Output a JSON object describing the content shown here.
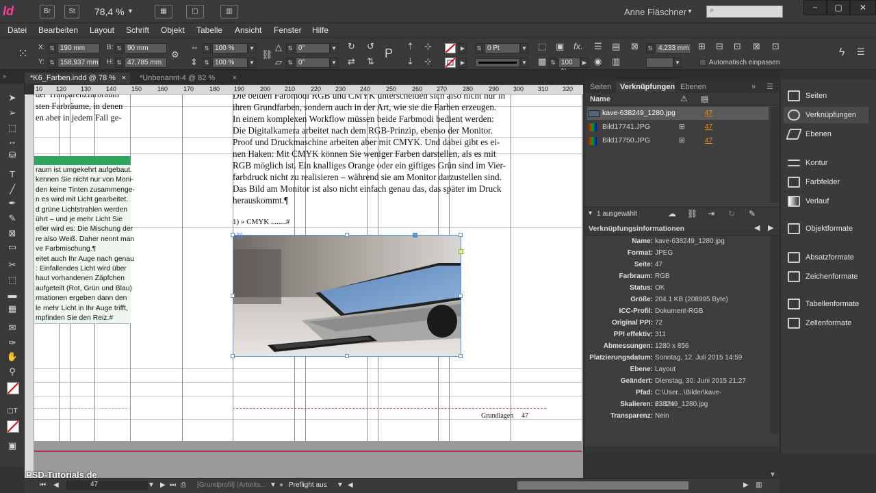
{
  "app": {
    "logo": "Id",
    "bridge_btn": "Br",
    "stock_btn": "St",
    "zoom_level": "78,4 %",
    "user_name": "Anne Fläschner"
  },
  "menu": [
    "Datei",
    "Bearbeiten",
    "Layout",
    "Schrift",
    "Objekt",
    "Tabelle",
    "Ansicht",
    "Fenster",
    "Hilfe"
  ],
  "control": {
    "x_label": "X:",
    "x_value": "190 mm",
    "y_label": "Y:",
    "y_value": "158,937 mm",
    "w_label": "B:",
    "w_value": "90 mm",
    "h_label": "H:",
    "h_value": "47,785 mm",
    "scale_x": "100 %",
    "scale_y": "100 %",
    "angle": "0°",
    "shear": "0°",
    "stroke_weight": "0 Pt",
    "opacity": "100 %",
    "fit_width": "4,233 mm",
    "auto_fit_label": "Automatisch einpassen"
  },
  "tabs": [
    {
      "label": "*K6_Farben.indd @ 78 %",
      "close": "×",
      "active": true
    },
    {
      "label": "*Unbenannt-4 @ 82 %",
      "close": "×",
      "active": false
    }
  ],
  "ruler": {
    "h_ticks": [
      "10",
      "120",
      "130",
      "140",
      "150",
      "160",
      "170",
      "180",
      "190",
      "200",
      "210",
      "220",
      "230",
      "240",
      "250",
      "260",
      "270",
      "280",
      "290",
      "300",
      "310",
      "320",
      "330"
    ]
  },
  "document": {
    "main_text": "Die beiden Farbmodi RGB und CMYK unterscheiden sich also nicht nur in\nihren Grundfarben, sondern auch in der Art, wie sie die Farben erzeugen.\nIn einem komplexen Workflow müssen beide Farbmodi bedient werden:\nDie Digitalkamera arbeitet nach dem RGB-Prinzip, ebenso der Monitor.\nProof und Druckmaschine arbeiten aber mit CMYK. Und dabei gibt es ei-\nnen Haken: Mit CMYK können Sie weniger Farben darstellen, als es mit\nRGB möglich ist. Ein knalliges Orange oder ein giftiges Grün sind im Vier-\nfarbdruck nicht zu realisieren – während sie am Monitor darzustellen sind.\nDas Bild am Monitor ist also nicht einfach genau das, das später im Druck\nherauskommt.¶",
    "left_text_top": "der Tranparenzfarbraum\nsten Farbräume, in denen\nen aber in jedem Fall ge-",
    "side_text": "raum ist umgekehrt aufgebaut.\nkennen Sie nicht nur von Moni-\nden keine Tinten zusammenge-\nn es wird mit Licht gearbeitet.\nd grüne Lichtstrahlen werden\nührt – und je mehr Licht Sie\neller wird es: Die Mischung der\nre also Weiß. Daher nennt man\nve Farbmischung.¶\neitet auch Ihr Auge nach genau\n: Einfallendes Licht wird über\nhaut vorhandenen Zäpfchen\naufgeteilt (Rot, Grün und Blau)\nrmationen ergeben dann den\nle mehr Licht in Ihr Auge trifft,\nmpfinden Sie den Reiz.#",
    "caption": "1) » CMYK ........#",
    "footer_label": "Grundlagen",
    "footer_page": "47"
  },
  "panel": {
    "tabs": [
      "Seiten",
      "Verknüpfungen",
      "Ebenen"
    ],
    "name_header": "Name",
    "links": [
      {
        "name": "kave-638249_1280.jpg",
        "page": "47",
        "selected": true
      },
      {
        "name": "Bild17741.JPG",
        "page": "47",
        "selected": false
      },
      {
        "name": "Bild17750.JPG",
        "page": "47",
        "selected": false
      }
    ],
    "selection_count": "1 ausgewählt",
    "info_title": "Verknüpfungsinformationen",
    "info": [
      {
        "key": "Name:",
        "value": "kave-638249_1280.jpg"
      },
      {
        "key": "Format:",
        "value": "JPEG"
      },
      {
        "key": "Seite:",
        "value": "47"
      },
      {
        "key": "Farbraum:",
        "value": "RGB"
      },
      {
        "key": "Status:",
        "value": "OK"
      },
      {
        "key": "Größe:",
        "value": "204.1 KB (208995 Byte)"
      },
      {
        "key": "ICC-Profil:",
        "value": "Dokument-RGB"
      },
      {
        "key": "Original PPI:",
        "value": "72"
      },
      {
        "key": "PPI effektiv:",
        "value": "311"
      },
      {
        "key": "Abmessungen:",
        "value": "1280 x 856"
      },
      {
        "key": "Platzierungsdatum:",
        "value": "Sonntag, 12. Juli 2015 14:59"
      },
      {
        "key": "Ebene:",
        "value": "Layout"
      },
      {
        "key": "Geändert:",
        "value": "Dienstag, 30. Juni 2015 21:27"
      },
      {
        "key": "Pfad:",
        "value": "C:\\User...\\Bilder\\kave-638249_1280.jpg"
      },
      {
        "key": "Skalieren:",
        "value": "23.1%"
      },
      {
        "key": "Transparenz:",
        "value": "Nein"
      }
    ]
  },
  "dock": [
    {
      "label": "Seiten",
      "icon": "pages-icon"
    },
    {
      "label": "Verknüpfungen",
      "icon": "links-icon"
    },
    {
      "label": "Ebenen",
      "icon": "layers-icon"
    },
    {
      "label": "Kontur",
      "icon": "stroke-icon"
    },
    {
      "label": "Farbfelder",
      "icon": "swatches-icon"
    },
    {
      "label": "Verlauf",
      "icon": "gradient-icon"
    },
    {
      "label": "Objektformate",
      "icon": "object-styles-icon"
    },
    {
      "label": "Absatzformate",
      "icon": "paragraph-styles-icon"
    },
    {
      "label": "Zeichenformate",
      "icon": "character-styles-icon"
    },
    {
      "label": "Tabellenformate",
      "icon": "table-styles-icon"
    },
    {
      "label": "Zellenformate",
      "icon": "cell-styles-icon"
    }
  ],
  "status": {
    "page_number": "47",
    "profile": "[Grundprofil] (Arbeits...",
    "preflight": "Preflight aus",
    "watermark": "PSD-Tutorials.de"
  }
}
